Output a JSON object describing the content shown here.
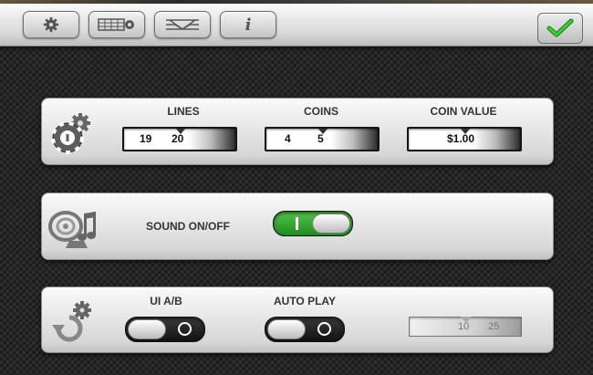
{
  "toolbar": {
    "buttons": [
      {
        "name": "settings",
        "icon": "gear-icon"
      },
      {
        "name": "paytable",
        "icon": "paytable-icon"
      },
      {
        "name": "paylines",
        "icon": "paylines-icon"
      },
      {
        "name": "info",
        "icon": "info-icon",
        "glyph": "i"
      }
    ],
    "confirm_icon": "checkmark-icon"
  },
  "bet_panel": {
    "icon": "chip-gear-icon",
    "lines": {
      "label": "LINES",
      "prev": "19",
      "value": "20"
    },
    "coins": {
      "label": "COINS",
      "prev": "4",
      "value": "5"
    },
    "coin_value": {
      "label": "COIN VALUE",
      "value": "$1.00"
    }
  },
  "sound_panel": {
    "icon": "speaker-music-icon",
    "label": "SOUND ON/OFF",
    "state": "on"
  },
  "options_panel": {
    "icon": "refresh-gear-icon",
    "ui_ab": {
      "label": "UI A/B",
      "state": "off"
    },
    "auto_play": {
      "label": "AUTO PLAY",
      "state": "off",
      "values": [
        "10",
        "25"
      ]
    }
  },
  "colors": {
    "accent_green": "#2ea32b"
  }
}
